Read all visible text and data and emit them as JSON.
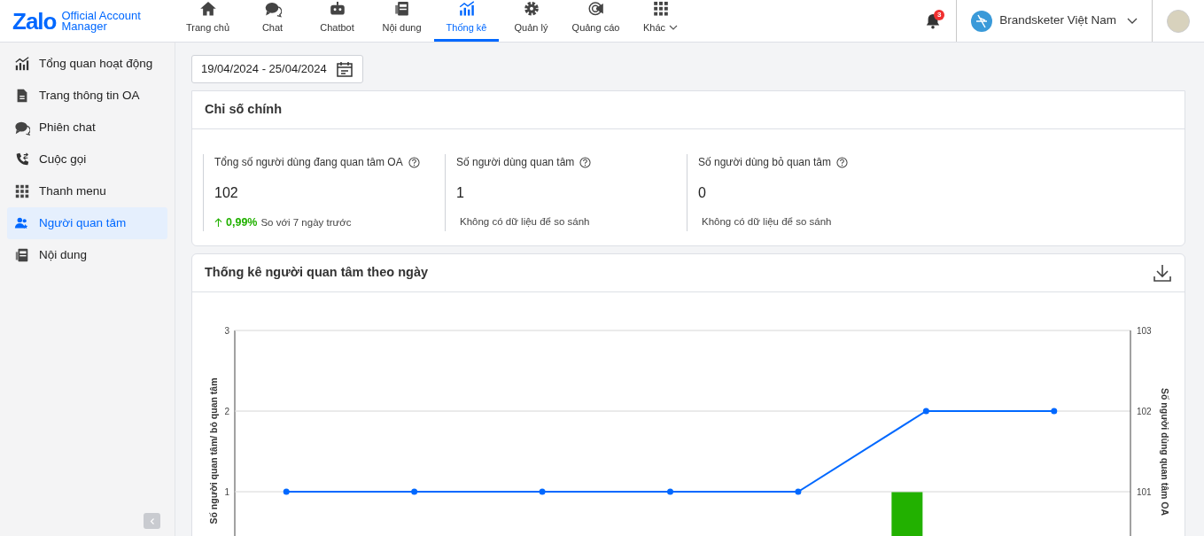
{
  "brand": {
    "logo": "Zalo",
    "line1": "Official Account",
    "line2": "Manager"
  },
  "nav": [
    {
      "label": "Trang chủ",
      "selected": false,
      "dropdown": false
    },
    {
      "label": "Chat",
      "selected": false,
      "dropdown": false
    },
    {
      "label": "Chatbot",
      "selected": false,
      "dropdown": false
    },
    {
      "label": "Nội dung",
      "selected": false,
      "dropdown": false
    },
    {
      "label": "Thống kê",
      "selected": true,
      "dropdown": false
    },
    {
      "label": "Quản lý",
      "selected": false,
      "dropdown": false
    },
    {
      "label": "Quảng cáo",
      "selected": false,
      "dropdown": false
    },
    {
      "label": "Khác",
      "selected": false,
      "dropdown": true
    }
  ],
  "notifications": {
    "count": "3"
  },
  "account": {
    "name": "Brandsketer Việt Nam"
  },
  "sidebar": {
    "items": [
      {
        "label": "Tổng quan hoạt động",
        "selected": false
      },
      {
        "label": "Trang thông tin OA",
        "selected": false
      },
      {
        "label": "Phiên chat",
        "selected": false
      },
      {
        "label": "Cuộc gọi",
        "selected": false
      },
      {
        "label": "Thanh menu",
        "selected": false
      },
      {
        "label": "Người quan tâm",
        "selected": true
      },
      {
        "label": "Nội dung",
        "selected": false
      }
    ]
  },
  "date_range": {
    "value": "19/04/2024 - 25/04/2024"
  },
  "key_metrics": {
    "title": "Chỉ số chính",
    "metrics": [
      {
        "label": "Tổng số người dùng đang quan tâm OA",
        "value": "102",
        "kind": "change",
        "change": "0,99%",
        "comparison": "So với 7 ngày trước"
      },
      {
        "label": "Số người dùng quan tâm",
        "value": "1",
        "kind": "nodata",
        "comparison": "Không có dữ liệu để so sánh"
      },
      {
        "label": "Số người dùng bỏ quan tâm",
        "value": "0",
        "kind": "nodata",
        "comparison": "Không có dữ liệu để so sánh"
      }
    ]
  },
  "daily_chart": {
    "title": "Thống kê người quan tâm theo ngày",
    "charts": [
      {
        "chart_data": {
          "type": "bar",
          "ylabel": "Số người quan tâm/ bỏ quan tâm",
          "ylim": [
            0,
            3
          ],
          "yticks": [
            1,
            2,
            3
          ],
          "categories": [
            null,
            null,
            null,
            null,
            null,
            null,
            null
          ],
          "series": [
            {
              "color": "#22b100",
              "values": [
                0,
                0,
                0,
                0,
                0,
                1,
                0
              ]
            }
          ]
        }
      },
      {
        "chart_data": {
          "type": "line",
          "ylabel": "Số người dùng quan tâm OA",
          "ylim": [
            100,
            103
          ],
          "yticks": [
            101,
            102,
            103
          ],
          "categories": [
            null,
            null,
            null,
            null,
            null,
            null,
            null
          ],
          "series": [
            {
              "color": "#0068ff",
              "values": [
                101,
                101,
                101,
                101,
                101,
                102,
                102
              ]
            }
          ]
        }
      }
    ]
  }
}
